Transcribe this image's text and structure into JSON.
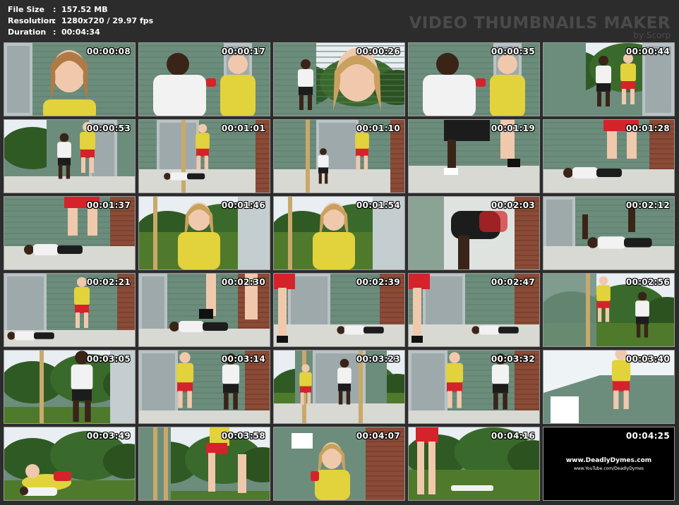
{
  "info": {
    "rows": [
      {
        "key": "File Size",
        "value": "157.52 MB"
      },
      {
        "key": "Resolution",
        "value": "1280x720 / 29.97 fps"
      },
      {
        "key": "Duration",
        "value": "00:04:34"
      }
    ],
    "colon": ":"
  },
  "watermark": {
    "title": "VIDEO THUMBNAILS MAKER",
    "byline": "by Scorp"
  },
  "thumbnails": [
    {
      "time": "00:00:08",
      "scene": "girl-closeup"
    },
    {
      "time": "00:00:17",
      "scene": "duo-closeup"
    },
    {
      "time": "00:00:26",
      "scene": "girl-front-man-back"
    },
    {
      "time": "00:00:35",
      "scene": "duo-closeup"
    },
    {
      "time": "00:00:44",
      "scene": "grapple"
    },
    {
      "time": "00:00:53",
      "scene": "porch-wide"
    },
    {
      "time": "00:01:01",
      "scene": "porch-man-down"
    },
    {
      "time": "00:01:10",
      "scene": "porch-man-crouch"
    },
    {
      "time": "00:01:19",
      "scene": "legs-closeup"
    },
    {
      "time": "00:01:28",
      "scene": "man-floor-girl-over"
    },
    {
      "time": "00:01:37",
      "scene": "man-floor-girl-over"
    },
    {
      "time": "00:01:46",
      "scene": "girl-closeup-garden"
    },
    {
      "time": "00:01:54",
      "scene": "girl-closeup-garden"
    },
    {
      "time": "00:02:03",
      "scene": "blurred-legs"
    },
    {
      "time": "00:02:12",
      "scene": "man-floor-arm-up"
    },
    {
      "time": "00:02:21",
      "scene": "man-floor-girl-stand"
    },
    {
      "time": "00:02:30",
      "scene": "stomp"
    },
    {
      "time": "00:02:39",
      "scene": "man-floor-girl-left"
    },
    {
      "time": "00:02:47",
      "scene": "man-floor-girl-left"
    },
    {
      "time": "00:02:56",
      "scene": "kick-yard"
    },
    {
      "time": "00:03:05",
      "scene": "man-standing-close"
    },
    {
      "time": "00:03:14",
      "scene": "duo-standing"
    },
    {
      "time": "00:03:23",
      "scene": "porch-wide-duo"
    },
    {
      "time": "00:03:32",
      "scene": "duo-standing"
    },
    {
      "time": "00:03:40",
      "scene": "girl-house-sky"
    },
    {
      "time": "00:03:49",
      "scene": "lawn-grapple"
    },
    {
      "time": "00:03:58",
      "scene": "girl-porch-trees"
    },
    {
      "time": "00:04:07",
      "scene": "girl-closeup-house"
    },
    {
      "time": "00:04:16",
      "scene": "lawn-legs"
    },
    {
      "time": "00:04:25",
      "scene": "promo",
      "promo_site": "www.DeadlyDymes.com",
      "promo_youtube": "www.YouTube.com/DeadlyDymes"
    }
  ],
  "colors": {
    "background": "#2c2c2c",
    "siding": "#6c8d7c",
    "brick": "#8a4b37",
    "grass": "#4f7a2c",
    "sky": "#e8eef2",
    "yellow_top": "#e2d23c",
    "red_shorts": "#d4232a",
    "white_shirt": "#f2f2f2",
    "skin_light": "#f0c9ad",
    "skin_dark": "#3a2418"
  }
}
